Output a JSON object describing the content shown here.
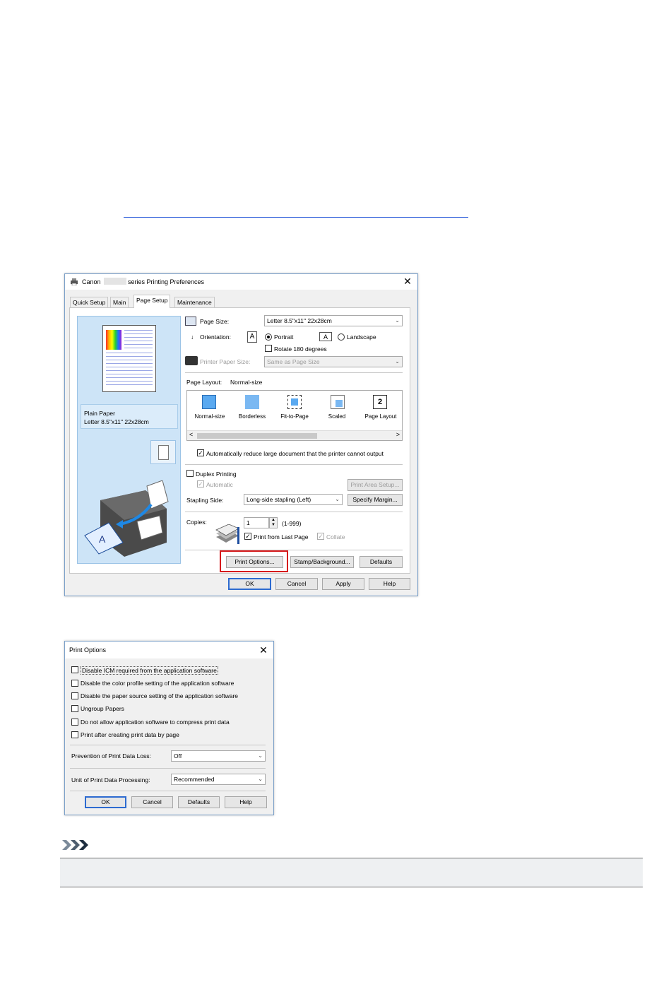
{
  "main_window": {
    "title_prefix": "Canon",
    "title_suffix": "series Printing Preferences",
    "tabs": [
      "Quick Setup",
      "Main",
      "Page Setup",
      "Maintenance"
    ],
    "active_tab": "Page Setup",
    "preview": {
      "media_type": "Plain Paper",
      "paper_size": "Letter 8.5\"x11\" 22x28cm"
    },
    "page_size": {
      "label": "Page Size:",
      "value": "Letter 8.5\"x11\" 22x28cm"
    },
    "orientation": {
      "label": "Orientation:",
      "portrait": "Portrait",
      "landscape": "Landscape",
      "rotate": "Rotate 180 degrees"
    },
    "printer_paper_size": {
      "label": "Printer Paper Size:",
      "value": "Same as Page Size"
    },
    "page_layout": {
      "label": "Page Layout:",
      "value": "Normal-size",
      "options": [
        "Normal-size",
        "Borderless",
        "Fit-to-Page",
        "Scaled",
        "Page Layout"
      ],
      "page_layout_badge": "2"
    },
    "auto_reduce": "Automatically reduce large document that the printer cannot output",
    "duplex": {
      "label": "Duplex Printing",
      "automatic": "Automatic",
      "print_area_setup": "Print Area Setup..."
    },
    "stapling": {
      "label": "Stapling Side:",
      "value": "Long-side stapling (Left)",
      "specify_margin": "Specify Margin..."
    },
    "copies": {
      "label": "Copies:",
      "value": "1",
      "range": "(1-999)",
      "print_from_last": "Print from Last Page",
      "collate": "Collate"
    },
    "buttons": {
      "print_options": "Print Options...",
      "stamp_background": "Stamp/Background...",
      "defaults": "Defaults",
      "ok": "OK",
      "cancel": "Cancel",
      "apply": "Apply",
      "help": "Help"
    },
    "colors": {
      "highlight": "#d6191c",
      "panel": "#cde4f7"
    }
  },
  "print_options_window": {
    "title": "Print Options",
    "checkboxes": [
      "Disable ICM required from the application software",
      "Disable the color profile setting of the application software",
      "Disable the paper source setting of the application software",
      "Ungroup Papers",
      "Do not allow application software to compress print data",
      "Print after creating print data by page"
    ],
    "prevention": {
      "label": "Prevention of Print Data Loss:",
      "value": "Off"
    },
    "unit": {
      "label": "Unit of Print Data Processing:",
      "value": "Recommended"
    },
    "buttons": {
      "ok": "OK",
      "cancel": "Cancel",
      "defaults": "Defaults",
      "help": "Help"
    }
  }
}
